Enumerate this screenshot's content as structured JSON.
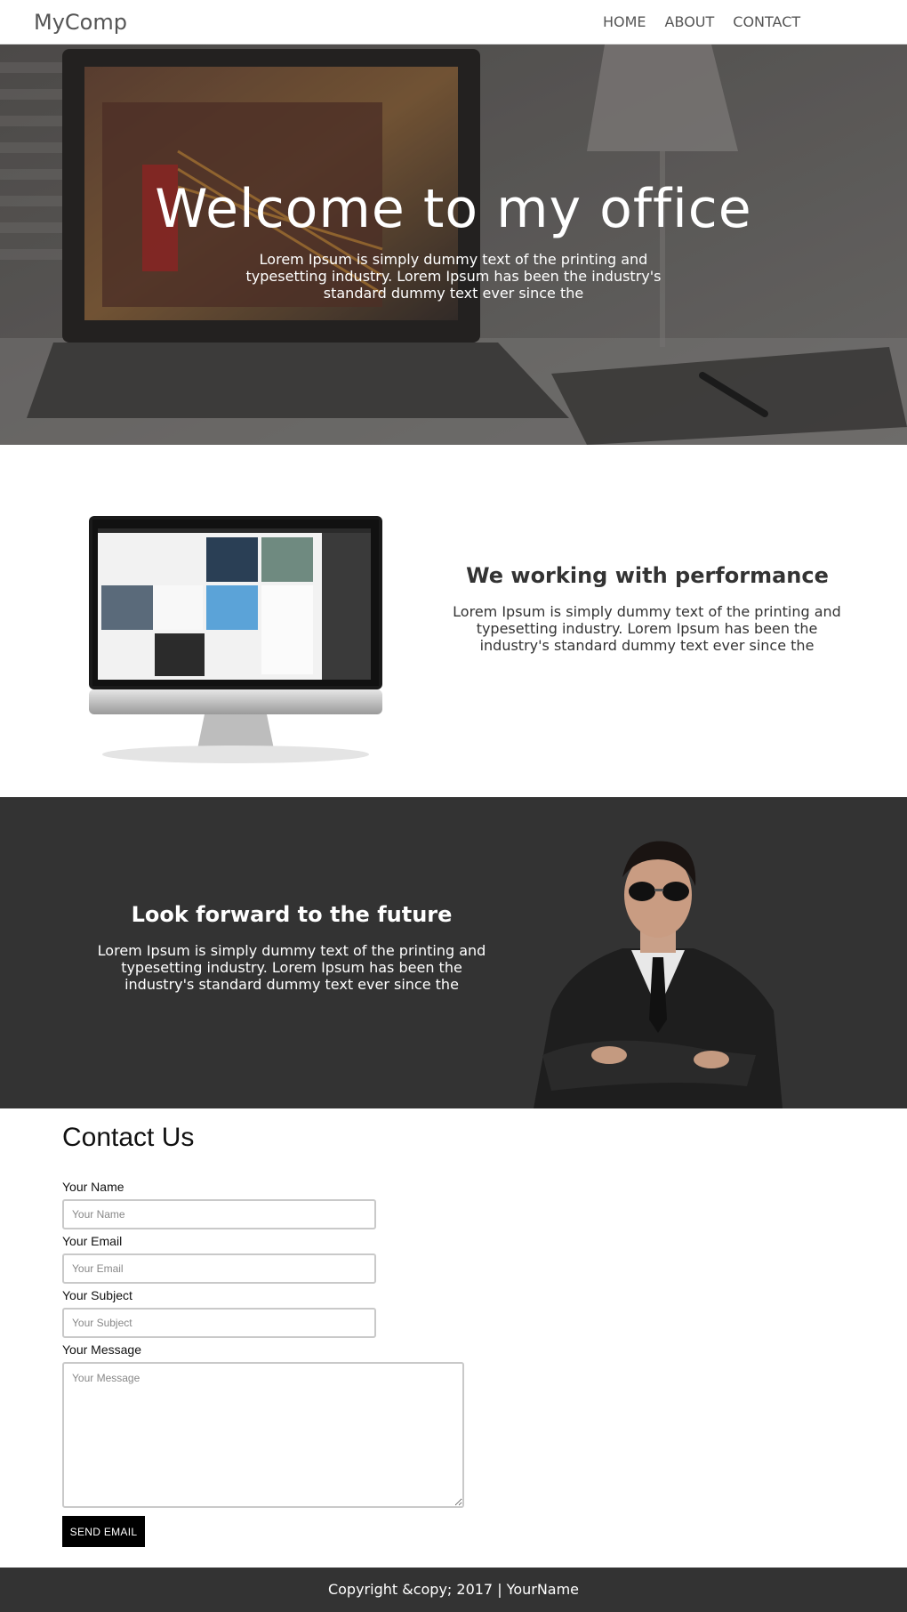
{
  "header": {
    "brand": "MyComp",
    "nav": [
      "HOME",
      "ABOUT",
      "CONTACT"
    ]
  },
  "hero": {
    "title": "Welcome to my office",
    "text": "Lorem Ipsum is simply dummy text of the printing and typesetting industry. Lorem Ipsum has been the industry's standard dummy text ever since the"
  },
  "performance": {
    "title": "We working with performance",
    "text": "Lorem Ipsum is simply dummy text of the printing and typesetting industry. Lorem Ipsum has been the industry's standard dummy text ever since the"
  },
  "future": {
    "title": "Look forward to the future",
    "text": "Lorem Ipsum is simply dummy text of the printing and typesetting industry. Lorem Ipsum has been the industry's standard dummy text ever since the"
  },
  "contact": {
    "title": "Contact Us",
    "name_label": "Your Name",
    "name_placeholder": "Your Name",
    "email_label": "Your Email",
    "email_placeholder": "Your Email",
    "subject_label": "Your Subject",
    "subject_placeholder": "Your Subject",
    "message_label": "Your Message",
    "message_placeholder": "Your Message",
    "send_label": "SEND EMAIL"
  },
  "footer": {
    "text": "Copyright &copy; 2017 | YourName"
  },
  "colors": {
    "dark_section": "#333333",
    "button": "#000000"
  }
}
